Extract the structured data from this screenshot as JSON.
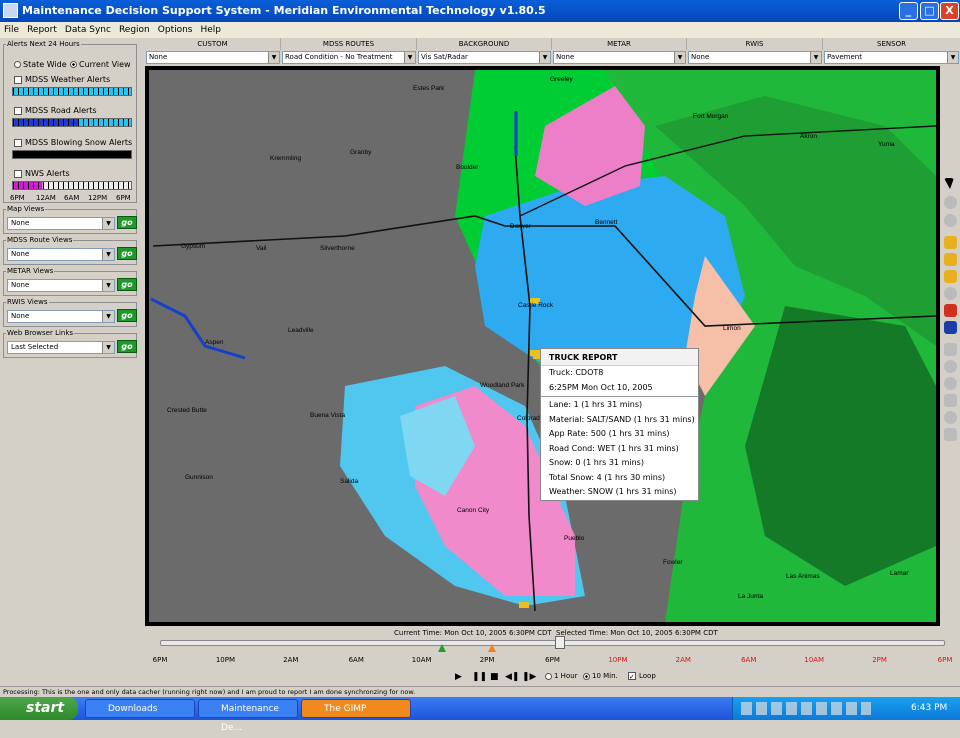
{
  "window": {
    "title": "Maintenance Decision Support System - Meridian Environmental Technology v1.80.5",
    "min": "_",
    "max": "□",
    "close": "X"
  },
  "menu": [
    "File",
    "Report",
    "Data Sync",
    "Region",
    "Options",
    "Help"
  ],
  "alerts": {
    "legend": "Alerts Next 24 Hours",
    "scope_options": [
      "State Wide",
      "Current View"
    ],
    "selected_scope": "Current View",
    "items": [
      {
        "label": "MDSS Weather Alerts"
      },
      {
        "label": "MDSS Road Alerts"
      },
      {
        "label": "MDSS Blowing Snow Alerts"
      },
      {
        "label": "NWS Alerts"
      }
    ],
    "hours": [
      "6PM",
      "12AM",
      "6AM",
      "12PM",
      "6PM"
    ]
  },
  "views": [
    {
      "legend": "Map Views",
      "value": "None",
      "go": "go"
    },
    {
      "legend": "MDSS Route Views",
      "value": "None",
      "go": "go"
    },
    {
      "legend": "METAR Views",
      "value": "None",
      "go": "go"
    },
    {
      "legend": "RWIS Views",
      "value": "None",
      "go": "go"
    },
    {
      "legend": "Web Browser Links",
      "value": "Last Selected",
      "go": "go"
    }
  ],
  "layers": [
    {
      "title": "CUSTOM",
      "value": "None"
    },
    {
      "title": "MDSS ROUTES",
      "value": "Road Condition - No Treatment"
    },
    {
      "title": "BACKGROUND",
      "value": "Vis Sat/Radar"
    },
    {
      "title": "METAR",
      "value": "None"
    },
    {
      "title": "RWIS",
      "value": "None"
    },
    {
      "title": "SENSOR",
      "value": "Pavement"
    }
  ],
  "map": {
    "cities": [
      "Estes Park",
      "Greeley",
      "Fort Morgan",
      "Akron",
      "Yuma",
      "Kremmling",
      "Granby",
      "Boulder",
      "Denver",
      "Bennett",
      "Gypsum",
      "Vail",
      "Silverthorne",
      "Castle Rock",
      "Limon",
      "Leadville",
      "Aspen",
      "Woodland Park",
      "Colorado Springs",
      "Crested Butte",
      "Buena Vista",
      "Salida",
      "Canon City",
      "Pueblo",
      "Gunnison",
      "Fowler",
      "Las Animas",
      "La Junta",
      "Lamar"
    ]
  },
  "truck_report": {
    "header": "TRUCK REPORT",
    "truck": "Truck: CDOT8",
    "time": "6:25PM Mon Oct 10, 2005",
    "lines": [
      "Lane: 1 (1 hrs 31 mins)",
      "Material: SALT/SAND (1 hrs 31 mins)",
      "App Rate: 500 (1 hrs 31 mins)",
      "Road Cond: WET (1 hrs 31 mins)",
      "Snow: 0 (1 hrs 31 mins)",
      "Total Snow: 4 (1 hrs 30 mins)",
      "Weather: SNOW (1 hrs 31 mins)"
    ]
  },
  "timeline": {
    "current": "Current Time: Mon Oct 10, 2005 6:30PM CDT",
    "selected": "Selected Time: Mon Oct 10, 2005 6:30PM CDT",
    "ticks": [
      {
        "label": "6PM",
        "color": "#000000"
      },
      {
        "label": "10PM",
        "color": "#000000"
      },
      {
        "label": "2AM",
        "color": "#000000"
      },
      {
        "label": "6AM",
        "color": "#000000"
      },
      {
        "label": "10AM",
        "color": "#000000"
      },
      {
        "label": "2PM",
        "color": "#000000"
      },
      {
        "label": "6PM",
        "color": "#000000"
      },
      {
        "label": "10PM",
        "color": "#e01010"
      },
      {
        "label": "2AM",
        "color": "#e01010"
      },
      {
        "label": "6AM",
        "color": "#e01010"
      },
      {
        "label": "10AM",
        "color": "#e01010"
      },
      {
        "label": "2PM",
        "color": "#e01010"
      },
      {
        "label": "6PM",
        "color": "#e01010"
      }
    ],
    "step_options": [
      "1 Hour",
      "10 Min."
    ],
    "selected_step": "10 Min.",
    "loop": "Loop"
  },
  "status": "Processing: This is the one and only data cacher (running right now) and I am proud to report I am done synchronzing for now.",
  "taskbar": {
    "start": "start",
    "tasks": [
      "Downloads",
      "Maintenance De...",
      "The GIMP"
    ],
    "clock": "6:43 PM"
  }
}
